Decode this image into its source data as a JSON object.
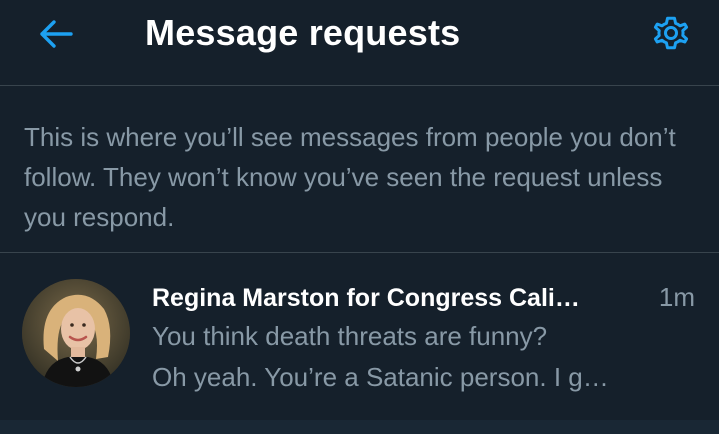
{
  "header": {
    "title": "Message requests",
    "back_icon": "arrow-left-icon",
    "settings_icon": "gear-icon",
    "accent_color": "#1da1f2"
  },
  "info": {
    "text": "This is where you’ll see messages from people you don’t follow. They won’t know you’ve seen the request unless you respond."
  },
  "requests": [
    {
      "sender": "Regina Marston for Congress Cali…",
      "time": "1m",
      "message_line1": "You think death threats are funny?",
      "message_line2": "Oh yeah. You’re a Satanic person. I g…"
    }
  ],
  "colors": {
    "background": "#15202b",
    "divider": "#38444d",
    "primary_text": "#ffffff",
    "secondary_text": "#8899a6"
  }
}
